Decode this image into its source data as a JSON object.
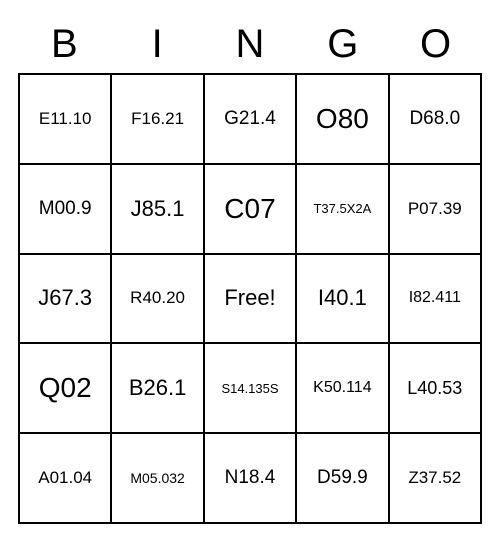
{
  "headers": [
    "B",
    "I",
    "N",
    "G",
    "O"
  ],
  "cells": [
    [
      {
        "text": "E11.10",
        "size": "fs-17"
      },
      {
        "text": "F16.21",
        "size": "fs-17"
      },
      {
        "text": "G21.4",
        "size": "fs-19"
      },
      {
        "text": "O80",
        "size": "fs-28"
      },
      {
        "text": "D68.0",
        "size": "fs-19"
      }
    ],
    [
      {
        "text": "M00.9",
        "size": "fs-19"
      },
      {
        "text": "J85.1",
        "size": "fs-22"
      },
      {
        "text": "C07",
        "size": "fs-28"
      },
      {
        "text": "T37.5X2A",
        "size": "fs-13"
      },
      {
        "text": "P07.39",
        "size": "fs-17"
      }
    ],
    [
      {
        "text": "J67.3",
        "size": "fs-22"
      },
      {
        "text": "R40.20",
        "size": "fs-17"
      },
      {
        "text": "Free!",
        "size": "fs-22"
      },
      {
        "text": "I40.1",
        "size": "fs-22"
      },
      {
        "text": "I82.411",
        "size": "fs-16"
      }
    ],
    [
      {
        "text": "Q02",
        "size": "fs-28"
      },
      {
        "text": "B26.1",
        "size": "fs-22"
      },
      {
        "text": "S14.135S",
        "size": "fs-13"
      },
      {
        "text": "K50.114",
        "size": "fs-16"
      },
      {
        "text": "L40.53",
        "size": "fs-18"
      }
    ],
    [
      {
        "text": "A01.04",
        "size": "fs-17"
      },
      {
        "text": "M05.032",
        "size": "fs-14"
      },
      {
        "text": "N18.4",
        "size": "fs-19"
      },
      {
        "text": "D59.9",
        "size": "fs-19"
      },
      {
        "text": "Z37.52",
        "size": "fs-17"
      }
    ]
  ]
}
